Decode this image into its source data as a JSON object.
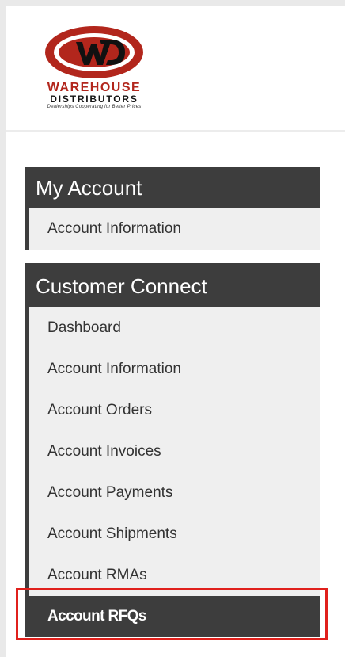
{
  "logo": {
    "text_line1": "WAREHOUSE",
    "text_line2": "DISTRIBUTORS",
    "tagline": "Dealerships Cooperating for Better Prices",
    "brand_color": "#b2261c"
  },
  "my_account": {
    "title": "My Account",
    "items": [
      {
        "label": "Account Information"
      }
    ]
  },
  "customer_connect": {
    "title": "Customer Connect",
    "items": [
      {
        "label": "Dashboard"
      },
      {
        "label": "Account Information"
      },
      {
        "label": "Account Orders"
      },
      {
        "label": "Account Invoices"
      },
      {
        "label": "Account Payments"
      },
      {
        "label": "Account Shipments"
      },
      {
        "label": "Account RMAs"
      },
      {
        "label": "Account RFQs",
        "active": true
      }
    ]
  },
  "colors": {
    "header_bg": "#3d3d3d",
    "item_bg": "#efefef",
    "highlight": "#e0201c"
  }
}
